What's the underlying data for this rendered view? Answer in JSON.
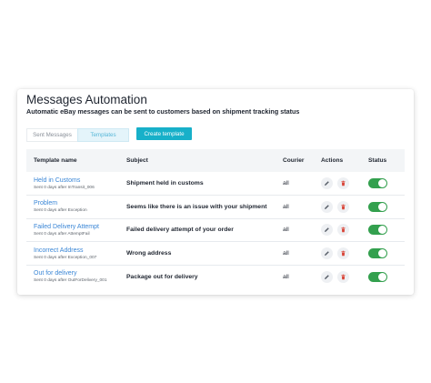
{
  "header": {
    "title": "Messages Automation",
    "subtitle": "Automatic eBay messages can be sent to customers based on shipment tracking status"
  },
  "tabs": [
    {
      "label": "Sent Messages",
      "active": false
    },
    {
      "label": "Templates",
      "active": true
    }
  ],
  "create_button_label": "Create template",
  "table": {
    "columns": [
      "Template name",
      "Subject",
      "Courier",
      "Actions",
      "Status"
    ],
    "rows": [
      {
        "name": "Held in Customs",
        "trigger": "Sent 0 days after InTransit_006",
        "subject": "Shipment held in customs",
        "courier": "all",
        "status": "on"
      },
      {
        "name": "Problem",
        "trigger": "Sent 0 days after Exception",
        "subject": "Seems like there is an issue with your shipment",
        "courier": "all",
        "status": "on"
      },
      {
        "name": "Failed Delivery Attempt",
        "trigger": "Sent 0 days after AttemptFail",
        "subject": "Failed delivery attempt of your order",
        "courier": "all",
        "status": "on"
      },
      {
        "name": "Incorrect Address",
        "trigger": "Sent 0 days after Exception_007",
        "subject": "Wrong address",
        "courier": "all",
        "status": "on"
      },
      {
        "name": "Out for delivery",
        "trigger": "Sent 0 days after OutForDelivery_001",
        "subject": "Package out for delivery",
        "courier": "all",
        "status": "on"
      }
    ]
  },
  "colors": {
    "accent": "#17b0c9",
    "link": "#3a86d6",
    "toggle_on": "#33a04e",
    "delete_icon": "#d9473a"
  },
  "icons": {
    "edit": "pencil-icon",
    "delete": "trash-icon"
  }
}
